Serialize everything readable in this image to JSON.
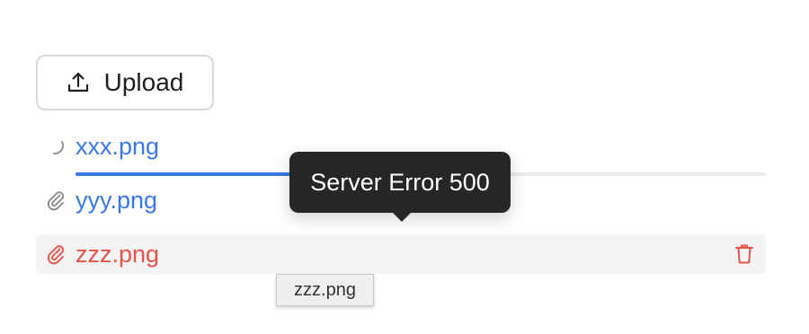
{
  "upload": {
    "label": "Upload",
    "icon": "upload-icon"
  },
  "files": [
    {
      "name": "xxx.png",
      "status": "uploading",
      "icon": "spinner-icon",
      "progress_percent": 33
    },
    {
      "name": "yyy.png",
      "status": "done",
      "icon": "paperclip-icon"
    },
    {
      "name": "zzz.png",
      "status": "error",
      "icon": "paperclip-icon",
      "action_icon": "trash-icon"
    }
  ],
  "tooltip": {
    "text": "Server Error 500"
  },
  "native_tooltip": {
    "text": "zzz.png"
  },
  "colors": {
    "link_blue": "#3b78e7",
    "error_red": "#e5534b",
    "tooltip_bg": "#262626",
    "progress_track": "#ececec"
  }
}
